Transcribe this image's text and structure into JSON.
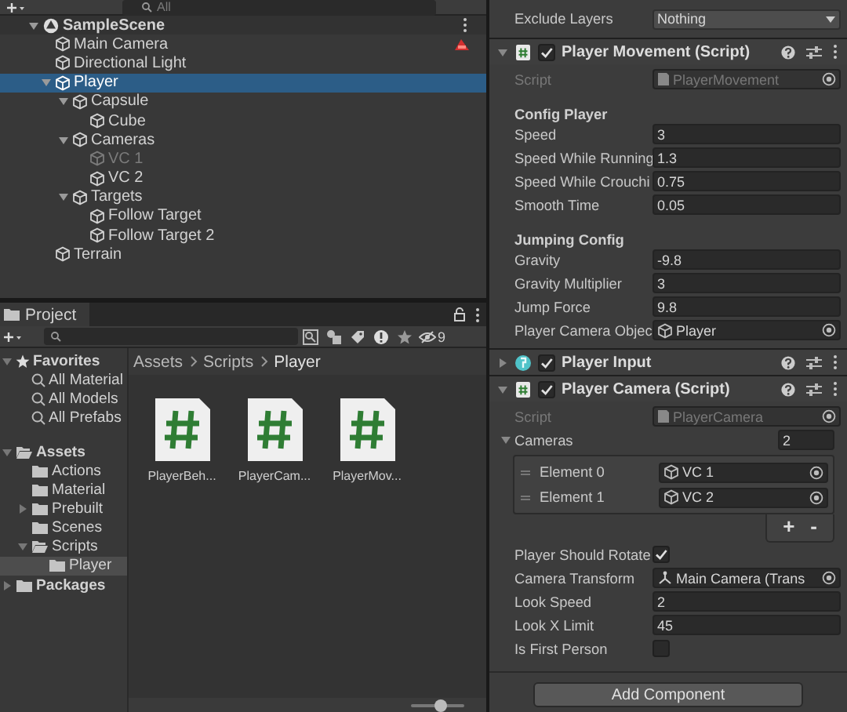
{
  "hierarchy": {
    "search": {
      "placeholder": "All"
    },
    "scene": {
      "label": "SampleScene",
      "expanded": true
    },
    "items": [
      {
        "label": "Main Camera",
        "selected": false,
        "disabled": false,
        "alert": true
      },
      {
        "label": "Directional Light",
        "selected": false,
        "disabled": false
      },
      {
        "label": "Player",
        "selected": true,
        "disabled": false,
        "expanded": true,
        "children": [
          {
            "label": "Capsule",
            "selected": false,
            "disabled": false,
            "expanded": true,
            "children": [
              {
                "label": "Cube",
                "selected": false,
                "disabled": false
              }
            ]
          },
          {
            "label": "Cameras",
            "selected": false,
            "disabled": false,
            "expanded": true,
            "children": [
              {
                "label": "VC 1",
                "selected": false,
                "disabled": true
              },
              {
                "label": "VC 2",
                "selected": false,
                "disabled": false
              }
            ]
          },
          {
            "label": "Targets",
            "selected": false,
            "disabled": false,
            "expanded": true,
            "children": [
              {
                "label": "Follow Target",
                "selected": false,
                "disabled": false
              },
              {
                "label": "Follow Target 2",
                "selected": false,
                "disabled": false
              }
            ]
          }
        ]
      },
      {
        "label": "Terrain",
        "selected": false,
        "disabled": false
      }
    ]
  },
  "project": {
    "tab": "Project",
    "hidden_count": "9",
    "sidebar": [
      {
        "label": "Favorites",
        "kind": "favorites",
        "selected": false,
        "expanded": true,
        "children": [
          {
            "label": "All Material",
            "kind": "search",
            "selected": false
          },
          {
            "label": "All Models",
            "kind": "search",
            "selected": false
          },
          {
            "label": "All Prefabs",
            "kind": "search",
            "selected": false
          }
        ]
      },
      {
        "label": "Assets",
        "kind": "folder",
        "selected": false,
        "expanded": true,
        "children": [
          {
            "label": "Actions",
            "kind": "folder",
            "selected": false
          },
          {
            "label": "Material",
            "kind": "folder",
            "selected": false
          },
          {
            "label": "Prebuilt",
            "kind": "folder",
            "selected": false,
            "expanded": false
          },
          {
            "label": "Scenes",
            "kind": "folder",
            "selected": false
          },
          {
            "label": "Scripts",
            "kind": "folder",
            "selected": false,
            "expanded": true,
            "children": [
              {
                "label": "Player",
                "kind": "folder",
                "selected": true
              }
            ]
          }
        ]
      },
      {
        "label": "Packages",
        "kind": "folder",
        "selected": false,
        "expanded": false
      }
    ],
    "breadcrumb": [
      "Assets",
      "Scripts",
      "Player"
    ],
    "files": [
      {
        "label": "PlayerBeh..."
      },
      {
        "label": "PlayerCam..."
      },
      {
        "label": "PlayerMov..."
      }
    ],
    "zoom_slider": {
      "level": 0.55
    }
  },
  "inspector": {
    "exclude_layers": {
      "label": "Exclude Layers",
      "value": "Nothing"
    },
    "components": [
      {
        "title": "Player Movement (Script)",
        "kind": "script",
        "expanded": true,
        "enabled": true,
        "fields": [
          {
            "kind": "script_ref",
            "label": "Script",
            "value": "PlayerMovement",
            "disabled": true
          },
          {
            "kind": "header",
            "label": "Config Player"
          },
          {
            "kind": "number",
            "label": "Speed",
            "value": "3"
          },
          {
            "kind": "number",
            "label": "Speed While Running",
            "value": "1.3"
          },
          {
            "kind": "number",
            "label": "Speed While Crouchi",
            "value": "0.75"
          },
          {
            "kind": "number",
            "label": "Smooth Time",
            "value": "0.05"
          },
          {
            "kind": "header",
            "label": "Jumping Config"
          },
          {
            "kind": "number",
            "label": "Gravity",
            "value": "-9.8"
          },
          {
            "kind": "number",
            "label": "Gravity Multiplier",
            "value": "3"
          },
          {
            "kind": "number",
            "label": "Jump Force",
            "value": "9.8"
          },
          {
            "kind": "object_ref",
            "label": "Player Camera Objec",
            "value": "Player",
            "disabled": false
          }
        ]
      },
      {
        "title": "Player Input",
        "kind": "input",
        "expanded": false,
        "enabled": true
      },
      {
        "title": "Player Camera (Script)",
        "kind": "script",
        "expanded": true,
        "enabled": true,
        "fields": [
          {
            "kind": "script_ref",
            "label": "Script",
            "value": "PlayerCamera",
            "disabled": true
          },
          {
            "kind": "list",
            "label": "Cameras",
            "count": "2",
            "expanded": true,
            "add": "+",
            "remove": "-",
            "elements": [
              {
                "label": "Element 0",
                "value": "VC 1",
                "kind": "object_ref"
              },
              {
                "label": "Element 1",
                "value": "VC 2",
                "kind": "object_ref"
              }
            ]
          },
          {
            "kind": "checkbox",
            "label": "Player Should Rotate",
            "checked": true
          },
          {
            "kind": "transform_ref",
            "label": "Camera Transform",
            "value": "Main Camera (Trans",
            "disabled": false
          },
          {
            "kind": "number",
            "label": "Look Speed",
            "value": "2"
          },
          {
            "kind": "number",
            "label": "Look X Limit",
            "value": "45"
          },
          {
            "kind": "checkbox",
            "label": "Is First Person",
            "checked": false
          }
        ]
      }
    ],
    "add_component": "Add Component"
  }
}
